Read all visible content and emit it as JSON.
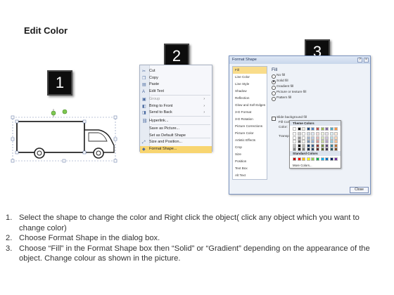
{
  "title": "Edit Color",
  "badges": [
    "1",
    "2",
    "3"
  ],
  "context_menu": {
    "items": [
      {
        "label": "Cut",
        "icon": "scissors-icon",
        "glyph": "✂"
      },
      {
        "label": "Copy",
        "icon": "copy-icon",
        "glyph": "❐"
      },
      {
        "label": "Paste",
        "icon": "paste-icon",
        "glyph": "▤"
      },
      {
        "label": "Edit Text",
        "icon": "edit-text-icon",
        "glyph": "A"
      },
      {
        "label": "Group",
        "icon": "group-icon",
        "glyph": "▣",
        "disabled": true,
        "submenu": true
      },
      {
        "label": "Bring to Front",
        "icon": "bring-front-icon",
        "glyph": "◧",
        "submenu": true
      },
      {
        "label": "Send to Back",
        "icon": "send-back-icon",
        "glyph": "◨",
        "submenu": true
      },
      {
        "label": "Hyperlink...",
        "icon": "hyperlink-icon",
        "glyph": "⛓"
      },
      {
        "label": "Save as Picture...",
        "icon": "",
        "glyph": ""
      },
      {
        "label": "Set as Default Shape",
        "icon": "",
        "glyph": ""
      },
      {
        "label": "Size and Position...",
        "icon": "size-position-icon",
        "glyph": "⤢"
      },
      {
        "label": "Format Shape...",
        "icon": "format-shape-icon",
        "glyph": "◆",
        "highlighted": true
      }
    ]
  },
  "dialog": {
    "title": "Format Shape",
    "title_buttons": [
      "?",
      "×"
    ],
    "categories": [
      "Fill",
      "Line Color",
      "Line Style",
      "Shadow",
      "Reflection",
      "Glow and Soft Edges",
      "3-D Format",
      "3-D Rotation",
      "Picture Corrections",
      "Picture Color",
      "Artistic Effects",
      "Crop",
      "Size",
      "Position",
      "Text Box",
      "Alt Text"
    ],
    "selected_category": "Fill",
    "pane_heading": "Fill",
    "fill_options": [
      {
        "label": "No fill",
        "on": false
      },
      {
        "label": "Solid fill",
        "on": true
      },
      {
        "label": "Gradient fill",
        "on": false
      },
      {
        "label": "Picture or texture fill",
        "on": false
      },
      {
        "label": "Pattern fill",
        "on": false
      },
      {
        "label": "Slide background fill",
        "on": false
      }
    ],
    "fill_color_heading": "Fill Color",
    "color_label": "Color:",
    "transparency_label": "Transpar",
    "color_button": "⊡ ▾",
    "close_label": "Close"
  },
  "palette": {
    "theme_heading": "Theme Colors",
    "standard_heading": "Standard Colors",
    "more": "More Colors...",
    "theme_top": [
      "#ffffff",
      "#000000",
      "#eeece1",
      "#1f497d",
      "#4f81bd",
      "#c0504d",
      "#9bbb59",
      "#8064a2",
      "#4bacc6",
      "#f79646"
    ],
    "standard": [
      "#c00000",
      "#ff0000",
      "#ffc000",
      "#ffff00",
      "#92d050",
      "#00b050",
      "#00b0f0",
      "#0070c0",
      "#002060",
      "#7030a0"
    ]
  },
  "steps": [
    {
      "num": "1.",
      "text": "Select the shape to change the color and Right click the object( click any object which you want to change color)"
    },
    {
      "num": "2.",
      "text": "Choose Format Shape in the dialog box."
    },
    {
      "num": "3.",
      "text": "Choose “Fill” in the Format Shape box then “Solid” or “Gradient” depending on the appearance of the object. Change colour as shown in the picture."
    }
  ]
}
